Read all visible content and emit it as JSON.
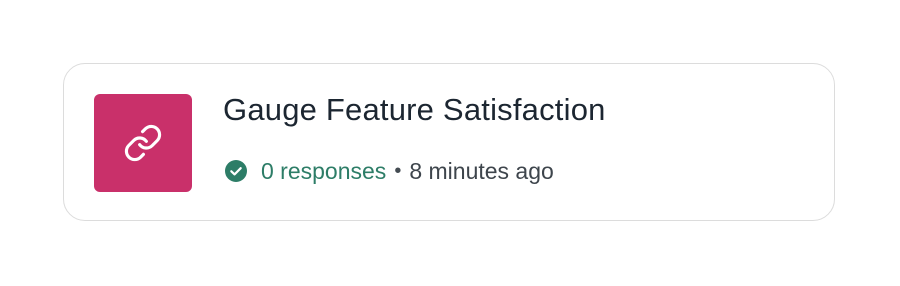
{
  "card": {
    "title": "Gauge Feature Satisfaction",
    "responses_text": "0 responses",
    "separator": "•",
    "time_text": "8 minutes ago",
    "thumbnail_icon": "link-icon",
    "status_icon": "check-circle-icon"
  },
  "colors": {
    "thumbnail_bg": "#c9306a",
    "title": "#1c2631",
    "responses": "#2d7d67",
    "meta_text": "#3e454c",
    "card_border": "#dcdcdc"
  }
}
